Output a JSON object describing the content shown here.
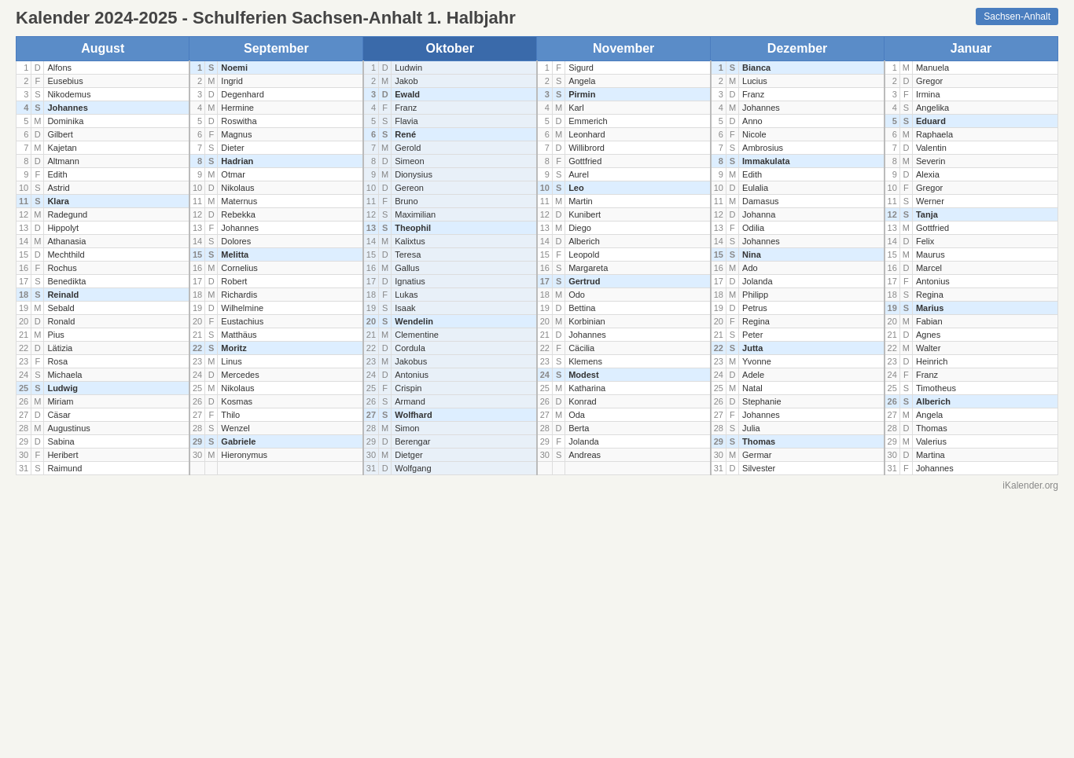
{
  "header": {
    "title": "Kalender 2024-2025 - Schulferien Sachsen-Anhalt 1. Halbjahr",
    "badge": "Sachsen-Anhalt"
  },
  "footer": "iKalender.org",
  "months": [
    {
      "label": "August",
      "colspan": 3
    },
    {
      "label": "September",
      "colspan": 3
    },
    {
      "label": "Oktober",
      "colspan": 3
    },
    {
      "label": "November",
      "colspan": 3
    },
    {
      "label": "Dezember",
      "colspan": 3
    },
    {
      "label": "Januar",
      "colspan": 3
    }
  ],
  "rows": [
    {
      "aug": {
        "d": "1",
        "l": "D",
        "n": "Alfons",
        "h": false
      },
      "sep": {
        "d": "1",
        "l": "S",
        "n": "Noemi",
        "h": true
      },
      "okt": {
        "d": "1",
        "l": "D",
        "n": "Ludwin",
        "h": false
      },
      "nov": {
        "d": "1",
        "l": "F",
        "n": "Sigurd",
        "h": false
      },
      "dez": {
        "d": "1",
        "l": "S",
        "n": "Bianca",
        "h": true
      },
      "jan": {
        "d": "1",
        "l": "M",
        "n": "Manuela",
        "h": false
      }
    },
    {
      "aug": {
        "d": "2",
        "l": "F",
        "n": "Eusebius",
        "h": false
      },
      "sep": {
        "d": "2",
        "l": "M",
        "n": "Ingrid",
        "h": false
      },
      "okt": {
        "d": "2",
        "l": "M",
        "n": "Jakob",
        "h": false
      },
      "nov": {
        "d": "2",
        "l": "S",
        "n": "Angela",
        "h": false
      },
      "dez": {
        "d": "2",
        "l": "M",
        "n": "Lucius",
        "h": false
      },
      "jan": {
        "d": "2",
        "l": "D",
        "n": "Gregor",
        "h": false
      }
    },
    {
      "aug": {
        "d": "3",
        "l": "S",
        "n": "Nikodemus",
        "h": false
      },
      "sep": {
        "d": "3",
        "l": "D",
        "n": "Degenhard",
        "h": false
      },
      "okt": {
        "d": "3",
        "l": "D",
        "n": "Ewald",
        "h": true
      },
      "nov": {
        "d": "3",
        "l": "S",
        "n": "Pirmin",
        "h": true
      },
      "dez": {
        "d": "3",
        "l": "D",
        "n": "Franz",
        "h": false
      },
      "jan": {
        "d": "3",
        "l": "F",
        "n": "Irmina",
        "h": false
      }
    },
    {
      "aug": {
        "d": "4",
        "l": "S",
        "n": "Johannes",
        "h": true
      },
      "sep": {
        "d": "4",
        "l": "M",
        "n": "Hermine",
        "h": false
      },
      "okt": {
        "d": "4",
        "l": "F",
        "n": "Franz",
        "h": false
      },
      "nov": {
        "d": "4",
        "l": "M",
        "n": "Karl",
        "h": false
      },
      "dez": {
        "d": "4",
        "l": "M",
        "n": "Johannes",
        "h": false
      },
      "jan": {
        "d": "4",
        "l": "S",
        "n": "Angelika",
        "h": false
      }
    },
    {
      "aug": {
        "d": "5",
        "l": "M",
        "n": "Dominika",
        "h": false
      },
      "sep": {
        "d": "5",
        "l": "D",
        "n": "Roswitha",
        "h": false
      },
      "okt": {
        "d": "5",
        "l": "S",
        "n": "Flavia",
        "h": false
      },
      "nov": {
        "d": "5",
        "l": "D",
        "n": "Emmerich",
        "h": false
      },
      "dez": {
        "d": "5",
        "l": "D",
        "n": "Anno",
        "h": false
      },
      "jan": {
        "d": "5",
        "l": "S",
        "n": "Eduard",
        "h": true
      }
    },
    {
      "aug": {
        "d": "6",
        "l": "D",
        "n": "Gilbert",
        "h": false
      },
      "sep": {
        "d": "6",
        "l": "F",
        "n": "Magnus",
        "h": false
      },
      "okt": {
        "d": "6",
        "l": "S",
        "n": "René",
        "h": true
      },
      "nov": {
        "d": "6",
        "l": "M",
        "n": "Leonhard",
        "h": false
      },
      "dez": {
        "d": "6",
        "l": "F",
        "n": "Nicole",
        "h": false
      },
      "jan": {
        "d": "6",
        "l": "M",
        "n": "Raphaela",
        "h": false
      }
    },
    {
      "aug": {
        "d": "7",
        "l": "M",
        "n": "Kajetan",
        "h": false
      },
      "sep": {
        "d": "7",
        "l": "S",
        "n": "Dieter",
        "h": false
      },
      "okt": {
        "d": "7",
        "l": "M",
        "n": "Gerold",
        "h": false
      },
      "nov": {
        "d": "7",
        "l": "D",
        "n": "Willibrord",
        "h": false
      },
      "dez": {
        "d": "7",
        "l": "S",
        "n": "Ambrosius",
        "h": false
      },
      "jan": {
        "d": "7",
        "l": "D",
        "n": "Valentin",
        "h": false
      }
    },
    {
      "aug": {
        "d": "8",
        "l": "D",
        "n": "Altmann",
        "h": false
      },
      "sep": {
        "d": "8",
        "l": "S",
        "n": "Hadrian",
        "h": true
      },
      "okt": {
        "d": "8",
        "l": "D",
        "n": "Simeon",
        "h": false
      },
      "nov": {
        "d": "8",
        "l": "F",
        "n": "Gottfried",
        "h": false
      },
      "dez": {
        "d": "8",
        "l": "S",
        "n": "Immakulata",
        "h": true
      },
      "jan": {
        "d": "8",
        "l": "M",
        "n": "Severin",
        "h": false
      }
    },
    {
      "aug": {
        "d": "9",
        "l": "F",
        "n": "Edith",
        "h": false
      },
      "sep": {
        "d": "9",
        "l": "M",
        "n": "Otmar",
        "h": false
      },
      "okt": {
        "d": "9",
        "l": "M",
        "n": "Dionysius",
        "h": false
      },
      "nov": {
        "d": "9",
        "l": "S",
        "n": "Aurel",
        "h": false
      },
      "dez": {
        "d": "9",
        "l": "M",
        "n": "Edith",
        "h": false
      },
      "jan": {
        "d": "9",
        "l": "D",
        "n": "Alexia",
        "h": false
      }
    },
    {
      "aug": {
        "d": "10",
        "l": "S",
        "n": "Astrid",
        "h": false
      },
      "sep": {
        "d": "10",
        "l": "D",
        "n": "Nikolaus",
        "h": false
      },
      "okt": {
        "d": "10",
        "l": "D",
        "n": "Gereon",
        "h": false
      },
      "nov": {
        "d": "10",
        "l": "S",
        "n": "Leo",
        "h": true
      },
      "dez": {
        "d": "10",
        "l": "D",
        "n": "Eulalia",
        "h": false
      },
      "jan": {
        "d": "10",
        "l": "F",
        "n": "Gregor",
        "h": false
      }
    },
    {
      "aug": {
        "d": "11",
        "l": "S",
        "n": "Klara",
        "h": true
      },
      "sep": {
        "d": "11",
        "l": "M",
        "n": "Maternus",
        "h": false
      },
      "okt": {
        "d": "11",
        "l": "F",
        "n": "Bruno",
        "h": false
      },
      "nov": {
        "d": "11",
        "l": "M",
        "n": "Martin",
        "h": false
      },
      "dez": {
        "d": "11",
        "l": "M",
        "n": "Damasus",
        "h": false
      },
      "jan": {
        "d": "11",
        "l": "S",
        "n": "Werner",
        "h": false
      }
    },
    {
      "aug": {
        "d": "12",
        "l": "M",
        "n": "Radegund",
        "h": false
      },
      "sep": {
        "d": "12",
        "l": "D",
        "n": "Rebekka",
        "h": false
      },
      "okt": {
        "d": "12",
        "l": "S",
        "n": "Maximilian",
        "h": false
      },
      "nov": {
        "d": "12",
        "l": "D",
        "n": "Kunibert",
        "h": false
      },
      "dez": {
        "d": "12",
        "l": "D",
        "n": "Johanna",
        "h": false
      },
      "jan": {
        "d": "12",
        "l": "S",
        "n": "Tanja",
        "h": true
      }
    },
    {
      "aug": {
        "d": "13",
        "l": "D",
        "n": "Hippolyt",
        "h": false
      },
      "sep": {
        "d": "13",
        "l": "F",
        "n": "Johannes",
        "h": false
      },
      "okt": {
        "d": "13",
        "l": "S",
        "n": "Theophil",
        "h": true
      },
      "nov": {
        "d": "13",
        "l": "M",
        "n": "Diego",
        "h": false
      },
      "dez": {
        "d": "13",
        "l": "F",
        "n": "Odilia",
        "h": false
      },
      "jan": {
        "d": "13",
        "l": "M",
        "n": "Gottfried",
        "h": false
      }
    },
    {
      "aug": {
        "d": "14",
        "l": "M",
        "n": "Athanasia",
        "h": false
      },
      "sep": {
        "d": "14",
        "l": "S",
        "n": "Dolores",
        "h": false
      },
      "okt": {
        "d": "14",
        "l": "M",
        "n": "Kalixtus",
        "h": false
      },
      "nov": {
        "d": "14",
        "l": "D",
        "n": "Alberich",
        "h": false
      },
      "dez": {
        "d": "14",
        "l": "S",
        "n": "Johannes",
        "h": false
      },
      "jan": {
        "d": "14",
        "l": "D",
        "n": "Felix",
        "h": false
      }
    },
    {
      "aug": {
        "d": "15",
        "l": "D",
        "n": "Mechthild",
        "h": false
      },
      "sep": {
        "d": "15",
        "l": "S",
        "n": "Melitta",
        "h": true
      },
      "okt": {
        "d": "15",
        "l": "D",
        "n": "Teresa",
        "h": false
      },
      "nov": {
        "d": "15",
        "l": "F",
        "n": "Leopold",
        "h": false
      },
      "dez": {
        "d": "15",
        "l": "S",
        "n": "Nina",
        "h": true
      },
      "jan": {
        "d": "15",
        "l": "M",
        "n": "Maurus",
        "h": false
      }
    },
    {
      "aug": {
        "d": "16",
        "l": "F",
        "n": "Rochus",
        "h": false
      },
      "sep": {
        "d": "16",
        "l": "M",
        "n": "Cornelius",
        "h": false
      },
      "okt": {
        "d": "16",
        "l": "M",
        "n": "Gallus",
        "h": false
      },
      "nov": {
        "d": "16",
        "l": "S",
        "n": "Margareta",
        "h": false
      },
      "dez": {
        "d": "16",
        "l": "M",
        "n": "Ado",
        "h": false
      },
      "jan": {
        "d": "16",
        "l": "D",
        "n": "Marcel",
        "h": false
      }
    },
    {
      "aug": {
        "d": "17",
        "l": "S",
        "n": "Benedikta",
        "h": false
      },
      "sep": {
        "d": "17",
        "l": "D",
        "n": "Robert",
        "h": false
      },
      "okt": {
        "d": "17",
        "l": "D",
        "n": "Ignatius",
        "h": false
      },
      "nov": {
        "d": "17",
        "l": "S",
        "n": "Gertrud",
        "h": true
      },
      "dez": {
        "d": "17",
        "l": "D",
        "n": "Jolanda",
        "h": false
      },
      "jan": {
        "d": "17",
        "l": "F",
        "n": "Antonius",
        "h": false
      }
    },
    {
      "aug": {
        "d": "18",
        "l": "S",
        "n": "Reinald",
        "h": true
      },
      "sep": {
        "d": "18",
        "l": "M",
        "n": "Richardis",
        "h": false
      },
      "okt": {
        "d": "18",
        "l": "F",
        "n": "Lukas",
        "h": false
      },
      "nov": {
        "d": "18",
        "l": "M",
        "n": "Odo",
        "h": false
      },
      "dez": {
        "d": "18",
        "l": "M",
        "n": "Philipp",
        "h": false
      },
      "jan": {
        "d": "18",
        "l": "S",
        "n": "Regina",
        "h": false
      }
    },
    {
      "aug": {
        "d": "19",
        "l": "M",
        "n": "Sebald",
        "h": false
      },
      "sep": {
        "d": "19",
        "l": "D",
        "n": "Wilhelmine",
        "h": false
      },
      "okt": {
        "d": "19",
        "l": "S",
        "n": "Isaak",
        "h": false
      },
      "nov": {
        "d": "19",
        "l": "D",
        "n": "Bettina",
        "h": false
      },
      "dez": {
        "d": "19",
        "l": "D",
        "n": "Petrus",
        "h": false
      },
      "jan": {
        "d": "19",
        "l": "S",
        "n": "Marius",
        "h": true
      }
    },
    {
      "aug": {
        "d": "20",
        "l": "D",
        "n": "Ronald",
        "h": false
      },
      "sep": {
        "d": "20",
        "l": "F",
        "n": "Eustachius",
        "h": false
      },
      "okt": {
        "d": "20",
        "l": "S",
        "n": "Wendelin",
        "h": true
      },
      "nov": {
        "d": "20",
        "l": "M",
        "n": "Korbinian",
        "h": false
      },
      "dez": {
        "d": "20",
        "l": "F",
        "n": "Regina",
        "h": false
      },
      "jan": {
        "d": "20",
        "l": "M",
        "n": "Fabian",
        "h": false
      }
    },
    {
      "aug": {
        "d": "21",
        "l": "M",
        "n": "Pius",
        "h": false
      },
      "sep": {
        "d": "21",
        "l": "S",
        "n": "Matthäus",
        "h": false
      },
      "okt": {
        "d": "21",
        "l": "M",
        "n": "Clementine",
        "h": false
      },
      "nov": {
        "d": "21",
        "l": "D",
        "n": "Johannes",
        "h": false
      },
      "dez": {
        "d": "21",
        "l": "S",
        "n": "Peter",
        "h": false
      },
      "jan": {
        "d": "21",
        "l": "D",
        "n": "Agnes",
        "h": false
      }
    },
    {
      "aug": {
        "d": "22",
        "l": "D",
        "n": "Lätizia",
        "h": false
      },
      "sep": {
        "d": "22",
        "l": "S",
        "n": "Moritz",
        "h": true
      },
      "okt": {
        "d": "22",
        "l": "D",
        "n": "Cordula",
        "h": false
      },
      "nov": {
        "d": "22",
        "l": "F",
        "n": "Cäcilia",
        "h": false
      },
      "dez": {
        "d": "22",
        "l": "S",
        "n": "Jutta",
        "h": true
      },
      "jan": {
        "d": "22",
        "l": "M",
        "n": "Walter",
        "h": false
      }
    },
    {
      "aug": {
        "d": "23",
        "l": "F",
        "n": "Rosa",
        "h": false
      },
      "sep": {
        "d": "23",
        "l": "M",
        "n": "Linus",
        "h": false
      },
      "okt": {
        "d": "23",
        "l": "M",
        "n": "Jakobus",
        "h": false
      },
      "nov": {
        "d": "23",
        "l": "S",
        "n": "Klemens",
        "h": false
      },
      "dez": {
        "d": "23",
        "l": "M",
        "n": "Yvonne",
        "h": false
      },
      "jan": {
        "d": "23",
        "l": "D",
        "n": "Heinrich",
        "h": false
      }
    },
    {
      "aug": {
        "d": "24",
        "l": "S",
        "n": "Michaela",
        "h": false
      },
      "sep": {
        "d": "24",
        "l": "D",
        "n": "Mercedes",
        "h": false
      },
      "okt": {
        "d": "24",
        "l": "D",
        "n": "Antonius",
        "h": false
      },
      "nov": {
        "d": "24",
        "l": "S",
        "n": "Modest",
        "h": true
      },
      "dez": {
        "d": "24",
        "l": "D",
        "n": "Adele",
        "h": false
      },
      "jan": {
        "d": "24",
        "l": "F",
        "n": "Franz",
        "h": false
      }
    },
    {
      "aug": {
        "d": "25",
        "l": "S",
        "n": "Ludwig",
        "h": true
      },
      "sep": {
        "d": "25",
        "l": "M",
        "n": "Nikolaus",
        "h": false
      },
      "okt": {
        "d": "25",
        "l": "F",
        "n": "Crispin",
        "h": false
      },
      "nov": {
        "d": "25",
        "l": "M",
        "n": "Katharina",
        "h": false
      },
      "dez": {
        "d": "25",
        "l": "M",
        "n": "Natal",
        "h": false
      },
      "jan": {
        "d": "25",
        "l": "S",
        "n": "Timotheus",
        "h": false
      }
    },
    {
      "aug": {
        "d": "26",
        "l": "M",
        "n": "Miriam",
        "h": false
      },
      "sep": {
        "d": "26",
        "l": "D",
        "n": "Kosmas",
        "h": false
      },
      "okt": {
        "d": "26",
        "l": "S",
        "n": "Armand",
        "h": false
      },
      "nov": {
        "d": "26",
        "l": "D",
        "n": "Konrad",
        "h": false
      },
      "dez": {
        "d": "26",
        "l": "D",
        "n": "Stephanie",
        "h": false
      },
      "jan": {
        "d": "26",
        "l": "S",
        "n": "Alberich",
        "h": true
      }
    },
    {
      "aug": {
        "d": "27",
        "l": "D",
        "n": "Cäsar",
        "h": false
      },
      "sep": {
        "d": "27",
        "l": "F",
        "n": "Thilo",
        "h": false
      },
      "okt": {
        "d": "27",
        "l": "S",
        "n": "Wolfhard",
        "h": true
      },
      "nov": {
        "d": "27",
        "l": "M",
        "n": "Oda",
        "h": false
      },
      "dez": {
        "d": "27",
        "l": "F",
        "n": "Johannes",
        "h": false
      },
      "jan": {
        "d": "27",
        "l": "M",
        "n": "Angela",
        "h": false
      }
    },
    {
      "aug": {
        "d": "28",
        "l": "M",
        "n": "Augustinus",
        "h": false
      },
      "sep": {
        "d": "28",
        "l": "S",
        "n": "Wenzel",
        "h": false
      },
      "okt": {
        "d": "28",
        "l": "M",
        "n": "Simon",
        "h": false
      },
      "nov": {
        "d": "28",
        "l": "D",
        "n": "Berta",
        "h": false
      },
      "dez": {
        "d": "28",
        "l": "S",
        "n": "Julia",
        "h": false
      },
      "jan": {
        "d": "28",
        "l": "D",
        "n": "Thomas",
        "h": false
      }
    },
    {
      "aug": {
        "d": "29",
        "l": "D",
        "n": "Sabina",
        "h": false
      },
      "sep": {
        "d": "29",
        "l": "S",
        "n": "Gabriele",
        "h": true
      },
      "okt": {
        "d": "29",
        "l": "D",
        "n": "Berengar",
        "h": false
      },
      "nov": {
        "d": "29",
        "l": "F",
        "n": "Jolanda",
        "h": false
      },
      "dez": {
        "d": "29",
        "l": "S",
        "n": "Thomas",
        "h": true
      },
      "jan": {
        "d": "29",
        "l": "M",
        "n": "Valerius",
        "h": false
      }
    },
    {
      "aug": {
        "d": "30",
        "l": "F",
        "n": "Heribert",
        "h": false
      },
      "sep": {
        "d": "30",
        "l": "M",
        "n": "Hieronymus",
        "h": false
      },
      "okt": {
        "d": "30",
        "l": "M",
        "n": "Dietger",
        "h": false
      },
      "nov": {
        "d": "30",
        "l": "S",
        "n": "Andreas",
        "h": false
      },
      "dez": {
        "d": "30",
        "l": "M",
        "n": "Germar",
        "h": false
      },
      "jan": {
        "d": "30",
        "l": "D",
        "n": "Martina",
        "h": false
      }
    },
    {
      "aug": {
        "d": "31",
        "l": "S",
        "n": "Raimund",
        "h": false
      },
      "sep": null,
      "okt": {
        "d": "31",
        "l": "D",
        "n": "Wolfgang",
        "h": false
      },
      "nov": null,
      "dez": {
        "d": "31",
        "l": "D",
        "n": "Silvester",
        "h": false
      },
      "jan": {
        "d": "31",
        "l": "F",
        "n": "Johannes",
        "h": false
      }
    }
  ]
}
